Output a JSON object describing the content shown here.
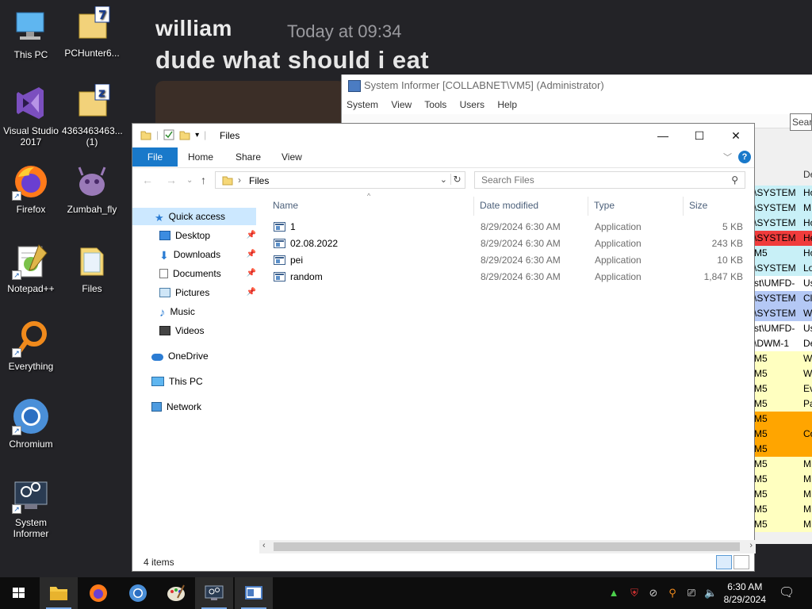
{
  "wallpaper": {
    "chat_name": "william",
    "chat_time": "Today at 09:34",
    "chat_message": "dude what should i eat"
  },
  "desktop_icons": [
    {
      "label": "This PC",
      "icon": "this-pc-icon"
    },
    {
      "label": "PCHunter6...",
      "icon": "archive-icon"
    },
    {
      "label": "Visual Studio 2017",
      "icon": "visual-studio-icon"
    },
    {
      "label": "4363463463... (1)",
      "icon": "archive-icon"
    },
    {
      "label": "Firefox",
      "icon": "firefox-icon"
    },
    {
      "label": "Zumbah_fly",
      "icon": "fly-icon"
    },
    {
      "label": "Notepad++",
      "icon": "notepad-icon"
    },
    {
      "label": "Files",
      "icon": "folder-icon"
    },
    {
      "label": "Everything",
      "icon": "everything-icon"
    },
    {
      "label": "Chromium",
      "icon": "chromium-icon"
    },
    {
      "label": "System Informer",
      "icon": "system-informer-icon"
    }
  ],
  "system_informer": {
    "title": "System Informer [COLLABNET\\VM5] (Administrator)",
    "menu": [
      "System",
      "View",
      "Tools",
      "Users",
      "Help"
    ],
    "search": "Sear",
    "column_header": "De",
    "rows": [
      {
        "a": "\\SYSTEM",
        "b": "Ho",
        "color": "#c8f0f7"
      },
      {
        "a": "\\SYSTEM",
        "b": "M",
        "color": "#c8f0f7"
      },
      {
        "a": "\\SYSTEM",
        "b": "Ho",
        "color": "#c8f0f7"
      },
      {
        "a": "\\SYSTEM",
        "b": "He",
        "color": "#f03c3c"
      },
      {
        "a": "M5",
        "b": "Ho",
        "color": "#c8f0f7"
      },
      {
        "a": "\\SYSTEM",
        "b": "Lo",
        "color": "#c8f0f7"
      },
      {
        "a": "st\\UMFD-",
        "b": "Us",
        "color": "#ffffff"
      },
      {
        "a": "\\SYSTEM",
        "b": "Cl",
        "color": "#b4c8f5"
      },
      {
        "a": "\\SYSTEM",
        "b": "W",
        "color": "#b4c8f5"
      },
      {
        "a": "st\\UMFD-",
        "b": "Us",
        "color": "#ffffff"
      },
      {
        "a": "\\DWM-1",
        "b": "De",
        "color": "#ffffff"
      },
      {
        "a": "M5",
        "b": "W",
        "color": "#ffffc0"
      },
      {
        "a": "M5",
        "b": "W",
        "color": "#ffffc0"
      },
      {
        "a": "M5",
        "b": "Ev",
        "color": "#ffffc0"
      },
      {
        "a": "M5",
        "b": "Pa",
        "color": "#ffffc0"
      },
      {
        "a": "M5",
        "b": "",
        "color": "#ffa500"
      },
      {
        "a": "M5",
        "b": "Co",
        "color": "#ffa500"
      },
      {
        "a": "M5",
        "b": "",
        "color": "#ffa500"
      },
      {
        "a": "M5",
        "b": "M",
        "color": "#ffffc0"
      },
      {
        "a": "M5",
        "b": "M",
        "color": "#ffffc0"
      },
      {
        "a": "M5",
        "b": "M",
        "color": "#ffffc0"
      },
      {
        "a": "M5",
        "b": "M",
        "color": "#ffffc0"
      },
      {
        "a": "M5",
        "b": "M",
        "color": "#ffffc0"
      }
    ]
  },
  "explorer": {
    "title": "Files",
    "ribbon_tabs": [
      "File",
      "Home",
      "Share",
      "View"
    ],
    "address_path": "Files",
    "search_placeholder": "Search Files",
    "nav": {
      "quick_access": "Quick access",
      "items": [
        "Desktop",
        "Downloads",
        "Documents",
        "Pictures",
        "Music",
        "Videos"
      ],
      "onedrive": "OneDrive",
      "this_pc": "This PC",
      "network": "Network"
    },
    "columns": [
      "Name",
      "Date modified",
      "Type",
      "Size"
    ],
    "files": [
      {
        "name": "1",
        "date": "8/29/2024 6:30 AM",
        "type": "Application",
        "size": "5 KB"
      },
      {
        "name": "02.08.2022",
        "date": "8/29/2024 6:30 AM",
        "type": "Application",
        "size": "243 KB"
      },
      {
        "name": "pei",
        "date": "8/29/2024 6:30 AM",
        "type": "Application",
        "size": "10 KB"
      },
      {
        "name": "random",
        "date": "8/29/2024 6:30 AM",
        "type": "Application",
        "size": "1,847 KB"
      }
    ],
    "status": "4 items"
  },
  "taskbar": {
    "time": "6:30 AM",
    "date": "8/29/2024"
  }
}
